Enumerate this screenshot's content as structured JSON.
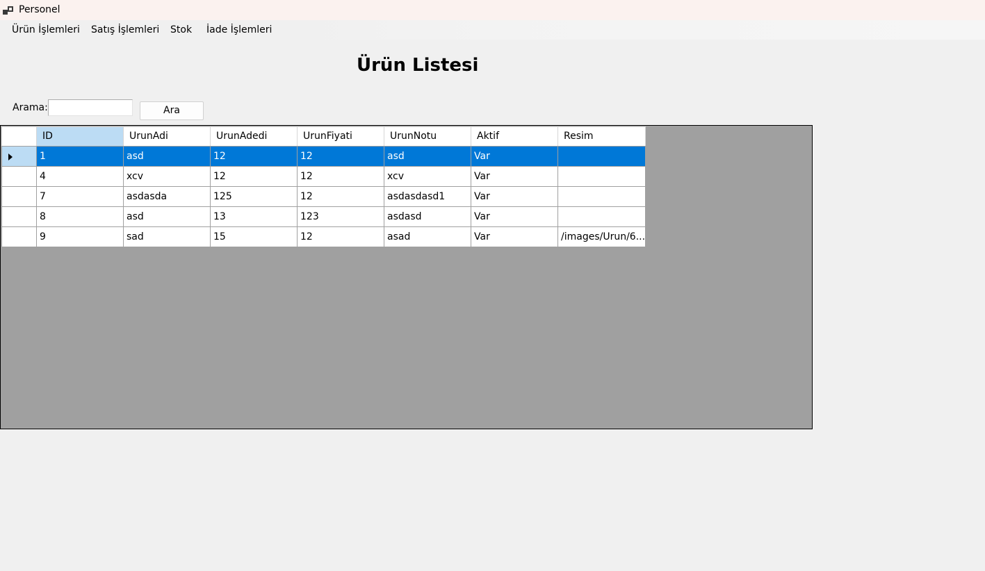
{
  "window": {
    "title": "Personel",
    "icon": "app-window-icon"
  },
  "menu": {
    "items": [
      {
        "label": "Ürün İşlemleri"
      },
      {
        "label": "Satış İşlemleri"
      },
      {
        "label": "Stok"
      },
      {
        "label": "İade İşlemleri"
      }
    ]
  },
  "page": {
    "title": "Ürün Listesi"
  },
  "search": {
    "label": "Arama:",
    "value": "",
    "button_label": "Ara"
  },
  "grid": {
    "columns": [
      "ID",
      "UrunAdi",
      "UrunAdedi",
      "UrunFiyati",
      "UrunNotu",
      "Aktif",
      "Resim"
    ],
    "selected_row": 0,
    "rows": [
      [
        "1",
        "asd",
        "12",
        "12",
        "asd",
        "Var",
        ""
      ],
      [
        "4",
        "xcv",
        "12",
        "12",
        "xcv",
        "Var",
        ""
      ],
      [
        "7",
        "asdasda",
        "125",
        "12",
        "asdasdasd1",
        "Var",
        ""
      ],
      [
        "8",
        "asd",
        "13",
        "123",
        "asdasd",
        "Var",
        ""
      ],
      [
        "9",
        "sad",
        "15",
        "12",
        "asad",
        "Var",
        "/images/Urun/6..."
      ]
    ],
    "colors": {
      "selection": "#0078d7",
      "header_selection": "#bcdcf4",
      "empty_area": "#a0a0a0"
    }
  }
}
